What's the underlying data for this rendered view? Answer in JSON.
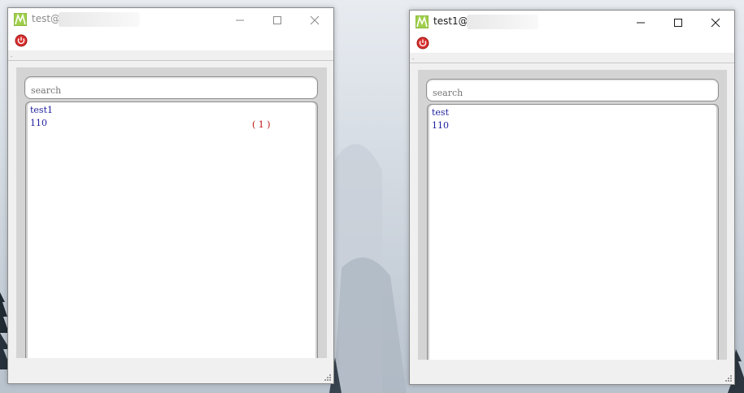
{
  "windows": [
    {
      "title": "test@",
      "active": false,
      "search_placeholder": "search",
      "contacts": [
        {
          "name": "test1",
          "number": "110",
          "badge": "( 1 )"
        }
      ]
    },
    {
      "title": "test1@",
      "active": true,
      "search_placeholder": "search",
      "contacts": [
        {
          "name": "test",
          "number": "110",
          "badge": ""
        }
      ]
    }
  ],
  "colors": {
    "power_icon": "#d83030",
    "contact_text": "#1f1fa0",
    "badge_text": "#c01010",
    "app_icon": "#8fbf3a"
  },
  "icons": [
    "app-icon",
    "minimize-icon",
    "maximize-icon",
    "close-icon",
    "power-icon",
    "resize-grip-icon"
  ]
}
